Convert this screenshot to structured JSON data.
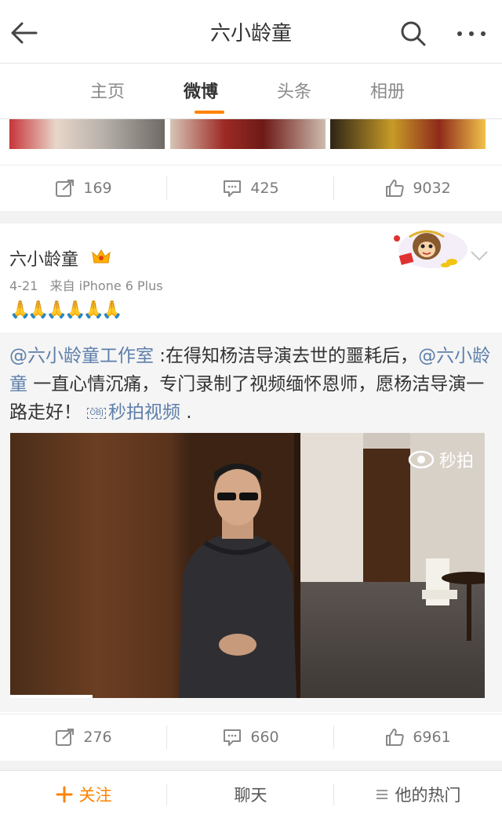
{
  "header": {
    "title": "六小龄童",
    "back_icon": "back-arrow-icon",
    "search_icon": "search-icon",
    "more_icon": "more-dots-icon"
  },
  "tabs": [
    {
      "label": "主页",
      "active": false
    },
    {
      "label": "微博",
      "active": true
    },
    {
      "label": "头条",
      "active": false
    },
    {
      "label": "相册",
      "active": false
    }
  ],
  "post1": {
    "actions": {
      "repost": "169",
      "comment": "425",
      "like": "9032"
    }
  },
  "post2": {
    "author": "六小龄童",
    "time": "4-21",
    "source": "来自 iPhone 6 Plus",
    "emoji": "🙏🙏🙏🙏🙏🙏",
    "repost": {
      "mention1": "@六小龄童工作室",
      "text1": " :在得知杨洁导演去世的噩耗后，",
      "mention2": "@六小龄童",
      "text2": " 一直心情沉痛，专门录制了视频缅怀恩师，愿杨洁导演一路走好！ ",
      "video_tag": "OBJ",
      "video_link": "秒拍视频",
      "text3": " .",
      "video_logo": "秒拍"
    },
    "actions": {
      "repost": "276",
      "comment": "660",
      "like": "6961"
    }
  },
  "bottom_bar": {
    "follow": "关注",
    "chat": "聊天",
    "hot": "他的热门"
  },
  "colors": {
    "accent": "#ff8200",
    "link": "#5d7fab"
  }
}
